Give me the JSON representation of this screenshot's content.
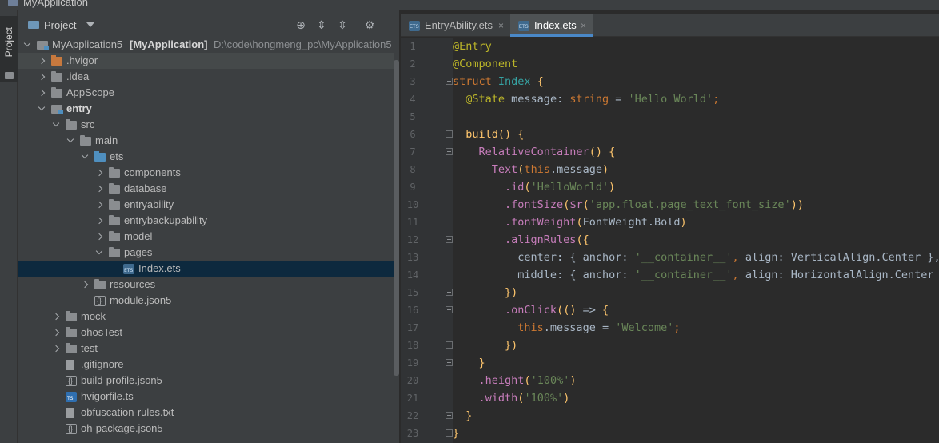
{
  "window": {
    "title": "MyApplication"
  },
  "side_strip": {
    "label": "Project"
  },
  "panel": {
    "title": "Project"
  },
  "tree": [
    {
      "name": "MyApplication5",
      "bold_suffix": "[MyApplication]",
      "path": "D:\\code\\hongmeng_pc\\MyApplication5",
      "icon": "module",
      "arrow": "open",
      "depth": 0,
      "bold": false
    },
    {
      "name": ".hvigor",
      "icon": "folder-orange",
      "arrow": "closed",
      "depth": 1,
      "highlight": "soft"
    },
    {
      "name": ".idea",
      "icon": "folder",
      "arrow": "closed",
      "depth": 1
    },
    {
      "name": "AppScope",
      "icon": "folder",
      "arrow": "closed",
      "depth": 1
    },
    {
      "name": "entry",
      "icon": "module",
      "arrow": "open",
      "depth": 1,
      "bold": true
    },
    {
      "name": "src",
      "icon": "folder",
      "arrow": "open",
      "depth": 2
    },
    {
      "name": "main",
      "icon": "folder",
      "arrow": "open",
      "depth": 3
    },
    {
      "name": "ets",
      "icon": "folder-blue",
      "arrow": "open",
      "depth": 4
    },
    {
      "name": "components",
      "icon": "folder",
      "arrow": "closed",
      "depth": 5
    },
    {
      "name": "database",
      "icon": "folder",
      "arrow": "closed",
      "depth": 5
    },
    {
      "name": "entryability",
      "icon": "folder",
      "arrow": "closed",
      "depth": 5
    },
    {
      "name": "entrybackupability",
      "icon": "folder",
      "arrow": "closed",
      "depth": 5
    },
    {
      "name": "model",
      "icon": "folder",
      "arrow": "closed",
      "depth": 5
    },
    {
      "name": "pages",
      "icon": "folder",
      "arrow": "open",
      "depth": 5
    },
    {
      "name": "Index.ets",
      "icon": "ets",
      "arrow": "none",
      "depth": 6,
      "highlight": "strong"
    },
    {
      "name": "resources",
      "icon": "folder",
      "arrow": "closed",
      "depth": 4
    },
    {
      "name": "module.json5",
      "icon": "json",
      "arrow": "none",
      "depth": 4
    },
    {
      "name": "mock",
      "icon": "folder",
      "arrow": "closed",
      "depth": 2
    },
    {
      "name": "ohosTest",
      "icon": "folder",
      "arrow": "closed",
      "depth": 2
    },
    {
      "name": "test",
      "icon": "folder",
      "arrow": "closed",
      "depth": 2
    },
    {
      "name": ".gitignore",
      "icon": "file",
      "arrow": "none",
      "depth": 2
    },
    {
      "name": "build-profile.json5",
      "icon": "json",
      "arrow": "none",
      "depth": 2
    },
    {
      "name": "hvigorfile.ts",
      "icon": "ts",
      "arrow": "none",
      "depth": 2
    },
    {
      "name": "obfuscation-rules.txt",
      "icon": "file",
      "arrow": "none",
      "depth": 2
    },
    {
      "name": "oh-package.json5",
      "icon": "json",
      "arrow": "none",
      "depth": 2
    }
  ],
  "tabs": [
    {
      "label": "EntryAbility.ets",
      "active": false
    },
    {
      "label": "Index.ets",
      "active": true
    }
  ],
  "colors": {
    "keyword": "#cc7832",
    "decorator": "#bbb529",
    "string": "#6a8759",
    "type": "#a9b7c6",
    "function": "#ffc66d",
    "property": "#9876aa",
    "plain": "#a9b7c6",
    "purple": "#c77dbb",
    "teal": "#36a3a3"
  },
  "code": [
    {
      "n": "1",
      "fold": false,
      "tokens": [
        [
          "@Entry",
          "decorator"
        ]
      ]
    },
    {
      "n": "2",
      "fold": false,
      "tokens": [
        [
          "@Component",
          "decorator"
        ]
      ]
    },
    {
      "n": "3",
      "fold": true,
      "tokens": [
        [
          "struct ",
          "keyword"
        ],
        [
          "Index",
          "teal"
        ],
        [
          " {",
          "function"
        ]
      ]
    },
    {
      "n": "4",
      "fold": false,
      "tokens": [
        [
          "  ",
          "plain"
        ],
        [
          "@State ",
          "decorator"
        ],
        [
          "message",
          "plain"
        ],
        [
          ": ",
          "plain"
        ],
        [
          "string",
          "keyword"
        ],
        [
          " = ",
          "plain"
        ],
        [
          "'Hello World'",
          "string"
        ],
        [
          ";",
          "keyword"
        ]
      ]
    },
    {
      "n": "5",
      "fold": false,
      "tokens": []
    },
    {
      "n": "6",
      "fold": true,
      "tokens": [
        [
          "  ",
          "plain"
        ],
        [
          "build",
          "function"
        ],
        [
          "() {",
          "function"
        ]
      ]
    },
    {
      "n": "7",
      "fold": true,
      "tokens": [
        [
          "    ",
          "plain"
        ],
        [
          "RelativeContainer",
          "purple"
        ],
        [
          "() {",
          "function"
        ]
      ]
    },
    {
      "n": "8",
      "fold": false,
      "tokens": [
        [
          "      ",
          "plain"
        ],
        [
          "Text",
          "purple"
        ],
        [
          "(",
          "function"
        ],
        [
          "this",
          "keyword"
        ],
        [
          ".message",
          "plain"
        ],
        [
          ")",
          "function"
        ]
      ]
    },
    {
      "n": "9",
      "fold": false,
      "tokens": [
        [
          "        ",
          "plain"
        ],
        [
          ".id",
          "purple"
        ],
        [
          "(",
          "function"
        ],
        [
          "'HelloWorld'",
          "string"
        ],
        [
          ")",
          "function"
        ]
      ]
    },
    {
      "n": "10",
      "fold": false,
      "tokens": [
        [
          "        ",
          "plain"
        ],
        [
          ".fontSize",
          "purple"
        ],
        [
          "(",
          "function"
        ],
        [
          "$r",
          "purple"
        ],
        [
          "(",
          "function"
        ],
        [
          "'app.float.page_text_font_size'",
          "string"
        ],
        [
          "))",
          "function"
        ]
      ]
    },
    {
      "n": "11",
      "fold": false,
      "tokens": [
        [
          "        ",
          "plain"
        ],
        [
          ".fontWeight",
          "purple"
        ],
        [
          "(",
          "function"
        ],
        [
          "FontWeight.Bold",
          "plain"
        ],
        [
          ")",
          "function"
        ]
      ]
    },
    {
      "n": "12",
      "fold": true,
      "tokens": [
        [
          "        ",
          "plain"
        ],
        [
          ".alignRules",
          "purple"
        ],
        [
          "({",
          "function"
        ]
      ]
    },
    {
      "n": "13",
      "fold": false,
      "tokens": [
        [
          "          ",
          "plain"
        ],
        [
          "center",
          "plain"
        ],
        [
          ": { ",
          "plain"
        ],
        [
          "anchor",
          "plain"
        ],
        [
          ": ",
          "plain"
        ],
        [
          "'__container__'",
          "string"
        ],
        [
          ", ",
          "keyword"
        ],
        [
          "align",
          "plain"
        ],
        [
          ": ",
          "plain"
        ],
        [
          "VerticalAlign.Center",
          "plain"
        ],
        [
          " },",
          "plain"
        ]
      ]
    },
    {
      "n": "14",
      "fold": false,
      "tokens": [
        [
          "          ",
          "plain"
        ],
        [
          "middle",
          "plain"
        ],
        [
          ": { ",
          "plain"
        ],
        [
          "anchor",
          "plain"
        ],
        [
          ": ",
          "plain"
        ],
        [
          "'__container__'",
          "string"
        ],
        [
          ", ",
          "keyword"
        ],
        [
          "align",
          "plain"
        ],
        [
          ": ",
          "plain"
        ],
        [
          "HorizontalAlign.Center",
          "plain"
        ],
        [
          " }",
          "plain"
        ]
      ]
    },
    {
      "n": "15",
      "fold": true,
      "tokens": [
        [
          "        ",
          "plain"
        ],
        [
          "})",
          "function"
        ]
      ]
    },
    {
      "n": "16",
      "fold": true,
      "tokens": [
        [
          "        ",
          "plain"
        ],
        [
          ".onClick",
          "purple"
        ],
        [
          "(() ",
          "function"
        ],
        [
          "=>",
          "plain"
        ],
        [
          " {",
          "function"
        ]
      ]
    },
    {
      "n": "17",
      "fold": false,
      "tokens": [
        [
          "          ",
          "plain"
        ],
        [
          "this",
          "keyword"
        ],
        [
          ".message = ",
          "plain"
        ],
        [
          "'Welcome'",
          "string"
        ],
        [
          ";",
          "keyword"
        ]
      ]
    },
    {
      "n": "18",
      "fold": true,
      "tokens": [
        [
          "        ",
          "plain"
        ],
        [
          "})",
          "function"
        ]
      ]
    },
    {
      "n": "19",
      "fold": true,
      "tokens": [
        [
          "    ",
          "plain"
        ],
        [
          "}",
          "function"
        ]
      ]
    },
    {
      "n": "20",
      "fold": false,
      "tokens": [
        [
          "    ",
          "plain"
        ],
        [
          ".height",
          "purple"
        ],
        [
          "(",
          "function"
        ],
        [
          "'100%'",
          "string"
        ],
        [
          ")",
          "function"
        ]
      ]
    },
    {
      "n": "21",
      "fold": false,
      "tokens": [
        [
          "    ",
          "plain"
        ],
        [
          ".width",
          "purple"
        ],
        [
          "(",
          "function"
        ],
        [
          "'100%'",
          "string"
        ],
        [
          ")",
          "function"
        ]
      ]
    },
    {
      "n": "22",
      "fold": true,
      "tokens": [
        [
          "  ",
          "plain"
        ],
        [
          "}",
          "function"
        ]
      ]
    },
    {
      "n": "23",
      "fold": true,
      "tokens": [
        [
          "}",
          "function"
        ]
      ]
    }
  ]
}
